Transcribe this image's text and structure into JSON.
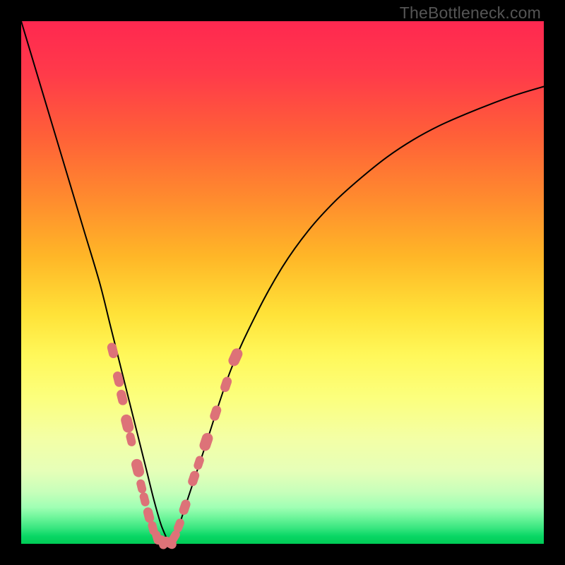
{
  "watermark": "TheBottleneck.com",
  "chart_data": {
    "type": "line",
    "title": "",
    "xlabel": "",
    "ylabel": "",
    "xlim": [
      0,
      100
    ],
    "ylim": [
      0,
      100
    ],
    "grid": false,
    "legend": false,
    "series": [
      {
        "name": "bottleneck-curve",
        "x": [
          0,
          3,
          6,
          9,
          12,
          15,
          17,
          19,
          21,
          22.5,
          24,
          25.5,
          27,
          28.5,
          30,
          32,
          35,
          40,
          45,
          50,
          55,
          60,
          65,
          70,
          75,
          80,
          85,
          90,
          95,
          100
        ],
        "y": [
          100,
          90,
          80,
          70,
          60,
          50,
          42,
          34,
          26,
          20,
          14,
          8,
          3,
          0.5,
          3,
          9,
          18,
          33,
          44,
          53,
          60,
          65.5,
          70,
          74,
          77.3,
          80,
          82.2,
          84.2,
          86,
          87.5
        ]
      }
    ],
    "markers": {
      "name": "data-points",
      "points": [
        {
          "x": 17.5,
          "y": 37.0,
          "r": 1.1
        },
        {
          "x": 18.6,
          "y": 31.5,
          "r": 1.1
        },
        {
          "x": 19.3,
          "y": 28.0,
          "r": 1.1
        },
        {
          "x": 20.3,
          "y": 23.0,
          "r": 1.3
        },
        {
          "x": 21.0,
          "y": 20.0,
          "r": 1.0
        },
        {
          "x": 22.3,
          "y": 14.5,
          "r": 1.3
        },
        {
          "x": 23.0,
          "y": 11.0,
          "r": 1.0
        },
        {
          "x": 23.6,
          "y": 8.5,
          "r": 1.0
        },
        {
          "x": 24.4,
          "y": 5.5,
          "r": 1.1
        },
        {
          "x": 25.2,
          "y": 3.0,
          "r": 1.0
        },
        {
          "x": 26.0,
          "y": 1.2,
          "r": 1.0
        },
        {
          "x": 27.0,
          "y": 0.3,
          "r": 1.0
        },
        {
          "x": 28.3,
          "y": 0.2,
          "r": 1.1
        },
        {
          "x": 29.3,
          "y": 1.3,
          "r": 1.0
        },
        {
          "x": 30.2,
          "y": 3.5,
          "r": 1.0
        },
        {
          "x": 31.3,
          "y": 7.0,
          "r": 1.1
        },
        {
          "x": 33.0,
          "y": 12.5,
          "r": 1.1
        },
        {
          "x": 34.0,
          "y": 15.5,
          "r": 1.0
        },
        {
          "x": 35.4,
          "y": 19.5,
          "r": 1.3
        },
        {
          "x": 37.2,
          "y": 25.0,
          "r": 1.1
        },
        {
          "x": 39.2,
          "y": 30.5,
          "r": 1.1
        },
        {
          "x": 41.0,
          "y": 35.7,
          "r": 1.3
        }
      ]
    },
    "background": {
      "type": "vertical-gradient",
      "stops": [
        {
          "pos": 0,
          "color": "#ff2850"
        },
        {
          "pos": 50,
          "color": "#ffd033"
        },
        {
          "pos": 72,
          "color": "#fcff7d"
        },
        {
          "pos": 100,
          "color": "#00cc56"
        }
      ]
    }
  }
}
